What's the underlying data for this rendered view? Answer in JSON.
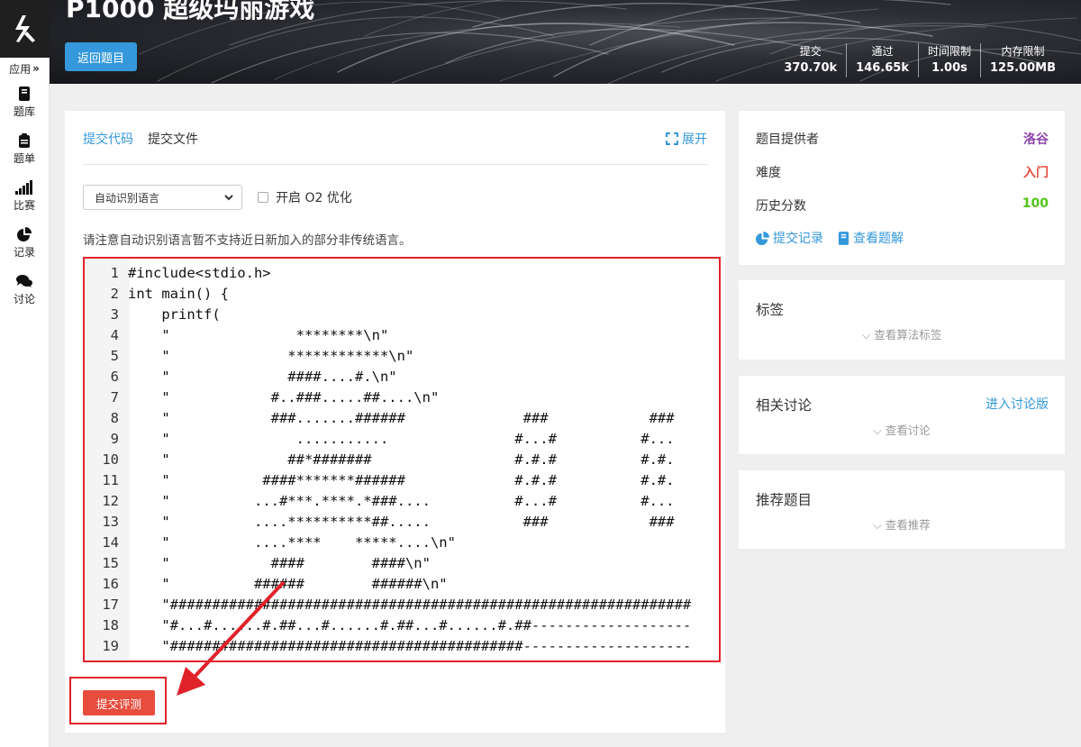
{
  "nav": {
    "app_label": "应用",
    "items": [
      {
        "label": "题库",
        "icon": "book-icon"
      },
      {
        "label": "题单",
        "icon": "clipboard-list-icon"
      },
      {
        "label": "比赛",
        "icon": "bar-signal-icon"
      },
      {
        "label": "记录",
        "icon": "pie-chart-icon"
      },
      {
        "label": "讨论",
        "icon": "chat-bubbles-icon"
      }
    ]
  },
  "header": {
    "title": "P1000 超级玛丽游戏",
    "back_label": "返回题目",
    "stats": [
      {
        "label": "提交",
        "value": "370.70k"
      },
      {
        "label": "通过",
        "value": "146.65k"
      },
      {
        "label": "时间限制",
        "value": "1.00s"
      },
      {
        "label": "内存限制",
        "value": "125.00MB"
      }
    ]
  },
  "editor_panel": {
    "tab_code": "提交代码",
    "tab_file": "提交文件",
    "expand_label": "展开",
    "language_select": "自动识别语言",
    "o2_label": "开启 O2 优化",
    "notice": "请注意自动识别语言暂不支持近日新加入的部分非传统语言。",
    "code_lines": [
      {
        "n": "1",
        "text": "#include<stdio.h>"
      },
      {
        "n": "2",
        "text": "int main() {"
      },
      {
        "n": "3",
        "text": "    printf("
      },
      {
        "n": "4",
        "text": "    \"               ********\\n\""
      },
      {
        "n": "5",
        "text": "    \"              ************\\n\""
      },
      {
        "n": "6",
        "text": "    \"              ####....#.\\n\""
      },
      {
        "n": "7",
        "text": "    \"            #..###.....##....\\n\""
      },
      {
        "n": "8",
        "text": "    \"            ###.......######              ###            ###"
      },
      {
        "n": "9",
        "text": "    \"               ...........               #...#          #..."
      },
      {
        "n": "10",
        "text": "    \"              ##*#######                 #.#.#          #.#."
      },
      {
        "n": "11",
        "text": "    \"           ####*******######             #.#.#          #.#."
      },
      {
        "n": "12",
        "text": "    \"          ...#***.****.*###....          #...#          #..."
      },
      {
        "n": "13",
        "text": "    \"          ....**********##.....           ###            ###"
      },
      {
        "n": "14",
        "text": "    \"          ....****    *****....\\n\""
      },
      {
        "n": "15",
        "text": "    \"            ####        ####\\n\""
      },
      {
        "n": "16",
        "text": "    \"          ######        ######\\n\""
      },
      {
        "n": "17",
        "text": "    \"##############################################################"
      },
      {
        "n": "18",
        "text": "    \"#...#......#.##...#......#.##...#......#.##-------------------"
      },
      {
        "n": "19",
        "text": "    \"##########################################--------------------"
      }
    ],
    "submit_label": "提交评测"
  },
  "info_card": {
    "provider_label": "题目提供者",
    "provider_value": "洛谷",
    "difficulty_label": "难度",
    "difficulty_value": "入门",
    "score_label": "历史分数",
    "score_value": "100",
    "records_link": "提交记录",
    "solution_link": "查看题解"
  },
  "tags_card": {
    "title": "标签",
    "action": "查看算法标签"
  },
  "discuss_card": {
    "title": "相关讨论",
    "link": "进入讨论版",
    "action": "查看讨论"
  },
  "recommend_card": {
    "title": "推荐题目",
    "action": "查看推荐"
  },
  "colors": {
    "accent_blue": "#3498db",
    "danger_red": "#e74c3c",
    "provider_purple": "#8e44ad",
    "success_green": "#52c41a",
    "highlight_border": "#e0222a"
  }
}
